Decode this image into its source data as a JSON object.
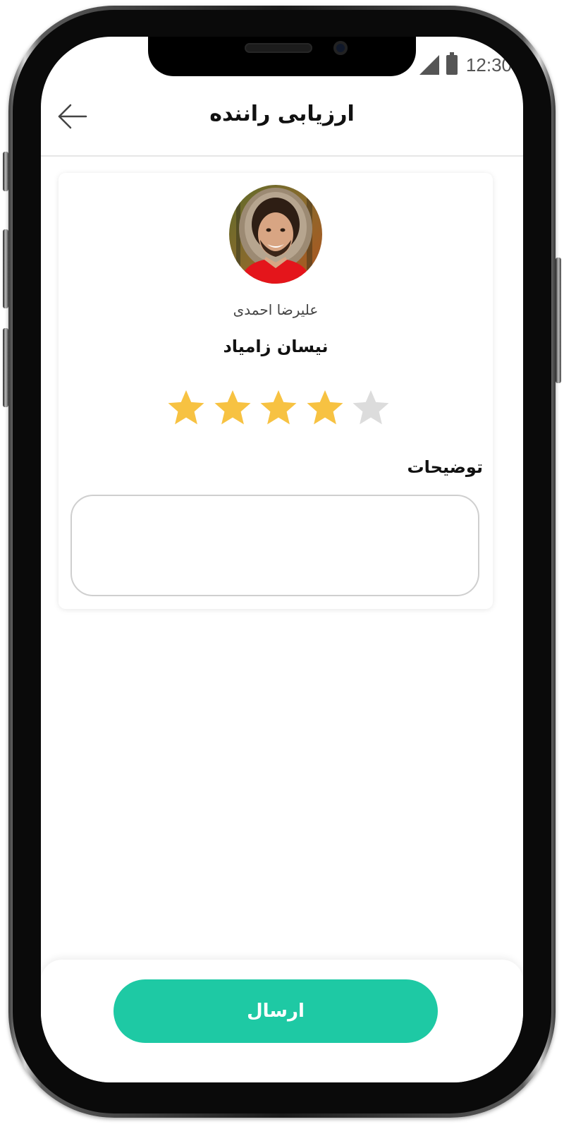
{
  "status_bar": {
    "time": "12:30",
    "signal_icon": "signal-icon",
    "battery_icon": "battery-icon"
  },
  "header": {
    "title": "ارزیابی راننده",
    "back_icon": "arrow-left-icon"
  },
  "driver": {
    "name": "علیرضا احمدی",
    "car": "نیسان زامیاد",
    "avatar": "driver-avatar"
  },
  "rating": {
    "value": 4,
    "max": 5,
    "filled_color": "#F7C242",
    "empty_color": "#DCDCDC"
  },
  "comments": {
    "label": "توضیحات",
    "value": ""
  },
  "actions": {
    "submit_label": "ارسال",
    "submit_color": "#1EC9A4"
  }
}
